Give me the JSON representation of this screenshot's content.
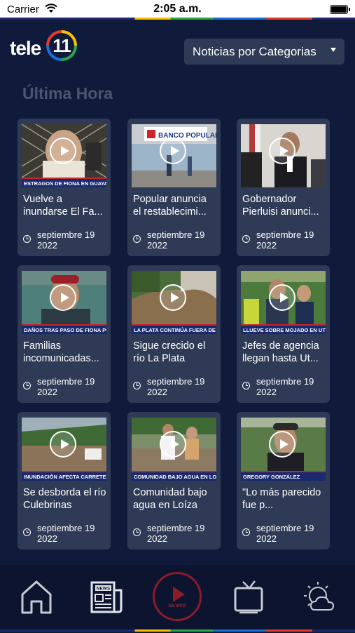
{
  "status_bar": {
    "carrier": "Carrier",
    "time": "2:05 a.m."
  },
  "header": {
    "logo_word": "tele",
    "logo_number": "11",
    "category_select": "Noticias por Categorias"
  },
  "section": {
    "title": "Última Hora"
  },
  "cards": [
    {
      "title": "Vuelve a inundarse El Fa...",
      "ticker": "ESTRAGOS DE FIONA EN GUAYANILLA",
      "date_line1": "septiembre 19",
      "date_line2": "2022"
    },
    {
      "title": "Popular anuncia el restablecimi...",
      "ticker": "",
      "date_line1": "septiembre 19",
      "date_line2": "2022"
    },
    {
      "title": "Gobernador Pierluisi anunci...",
      "ticker": "",
      "date_line1": "septiembre 19",
      "date_line2": "2022"
    },
    {
      "title": "Familias incomunicadas...",
      "ticker": "DAÑOS TRAS PASO DE FIONA POR PATILLAS",
      "date_line1": "septiembre 19",
      "date_line2": "2022"
    },
    {
      "title": "Sigue crecido el río La Plata",
      "ticker": "LA PLATA CONTINÚA FUERA DE SU CAUCE",
      "date_line1": "septiembre 19",
      "date_line2": "2022"
    },
    {
      "title": "Jefes de agencia llegan hasta Ut...",
      "ticker": "LLUEVE SOBRE MOJADO EN UTUADO",
      "date_line1": "septiembre 19",
      "date_line2": "2022"
    },
    {
      "title": "Se desborda el río Culebrinas",
      "ticker": "INUNDACIÓN AFECTA CARRETERA",
      "date_line1": "septiembre 19",
      "date_line2": "2022"
    },
    {
      "title": "Comunidad bajo agua en Loíza",
      "ticker": "COMUNIDAD BAJO AGUA EN LOÍZA",
      "date_line1": "septiembre 19",
      "date_line2": "2022"
    },
    {
      "title": "\"Lo más parecido fue p...",
      "ticker": "GREGORY GONZÁLEZ",
      "date_line1": "septiembre 19",
      "date_line2": "2022"
    }
  ],
  "bottom_nav": {
    "live_label": "EN VIVO",
    "news_icon_label": "NEWS",
    "items": [
      "home-icon",
      "news-icon",
      "live-play-icon",
      "tv-icon",
      "weather-icon"
    ]
  },
  "colors": {
    "background": "#101a3a",
    "card": "#2f3a56",
    "live_red": "#8d1b2a",
    "section_title": "#4d5670"
  }
}
